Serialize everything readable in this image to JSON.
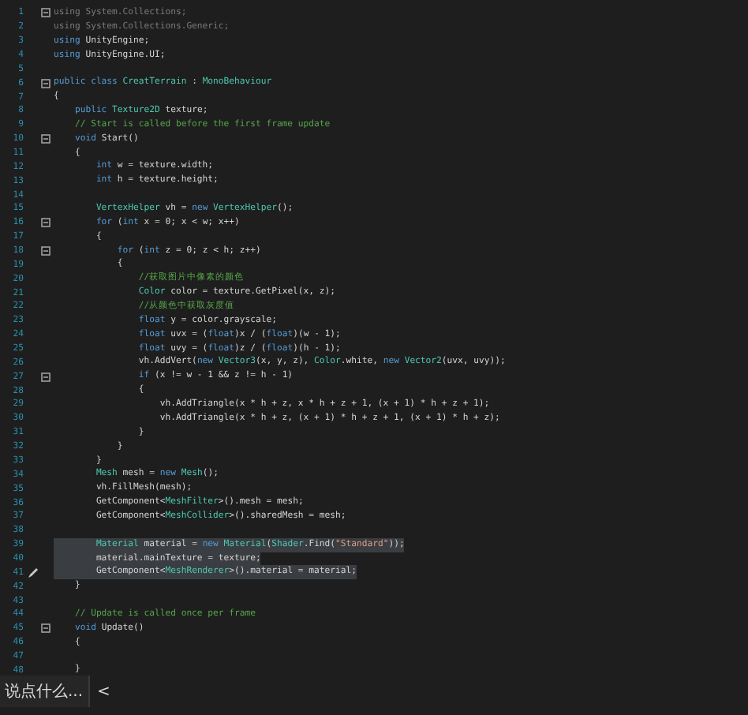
{
  "editor": {
    "lines": [
      {
        "number": "1",
        "fold": true,
        "selected": false,
        "tokens": [
          {
            "kind": "dim",
            "text": "using System.Collections;"
          }
        ]
      },
      {
        "number": "2",
        "fold": false,
        "selected": false,
        "tokens": [
          {
            "kind": "dim",
            "text": "using System.Collections.Generic;"
          }
        ]
      },
      {
        "number": "3",
        "fold": false,
        "selected": false,
        "tokens": [
          {
            "kind": "keyword",
            "text": "using"
          },
          {
            "kind": "plain",
            "text": " UnityEngine;"
          }
        ]
      },
      {
        "number": "4",
        "fold": false,
        "selected": false,
        "tokens": [
          {
            "kind": "keyword",
            "text": "using"
          },
          {
            "kind": "plain",
            "text": " UnityEngine.UI;"
          }
        ]
      },
      {
        "number": "5",
        "fold": false,
        "selected": false
      },
      {
        "number": "6",
        "fold": true,
        "selected": false,
        "tokens": [
          {
            "kind": "keyword",
            "text": "public class"
          },
          {
            "kind": "type",
            "text": " CreatTerrain"
          },
          {
            "kind": "plain",
            "text": " : "
          },
          {
            "kind": "type",
            "text": "MonoBehaviour"
          }
        ]
      },
      {
        "number": "7",
        "fold": false,
        "selected": false,
        "tokens": [
          {
            "kind": "plain",
            "text": "{"
          }
        ]
      },
      {
        "number": "8",
        "fold": false,
        "selected": false,
        "tokens": [
          {
            "kind": "keyword",
            "text": "    public"
          },
          {
            "kind": "type",
            "text": " Texture2D"
          },
          {
            "kind": "plain",
            "text": " texture;"
          }
        ]
      },
      {
        "number": "9",
        "fold": false,
        "selected": false,
        "tokens": [
          {
            "kind": "comment",
            "text": "    // Start is called before the first frame update"
          }
        ]
      },
      {
        "number": "10",
        "fold": true,
        "selected": false,
        "tokens": [
          {
            "kind": "keyword",
            "text": "    void"
          },
          {
            "kind": "plain",
            "text": " Start()"
          }
        ]
      },
      {
        "number": "11",
        "fold": false,
        "selected": false,
        "tokens": [
          {
            "kind": "plain",
            "text": "    {"
          }
        ]
      },
      {
        "number": "12",
        "fold": false,
        "selected": false,
        "tokens": [
          {
            "kind": "keyword",
            "text": "        int"
          },
          {
            "kind": "plain",
            "text": " w = texture.width;"
          }
        ]
      },
      {
        "number": "13",
        "fold": false,
        "selected": false,
        "tokens": [
          {
            "kind": "keyword",
            "text": "        int"
          },
          {
            "kind": "plain",
            "text": " h = texture.height;"
          }
        ]
      },
      {
        "number": "14",
        "fold": false,
        "selected": false
      },
      {
        "number": "15",
        "fold": false,
        "selected": false,
        "tokens": [
          {
            "kind": "type",
            "text": "        VertexHelper"
          },
          {
            "kind": "plain",
            "text": " vh = "
          },
          {
            "kind": "keyword",
            "text": "new"
          },
          {
            "kind": "type",
            "text": " VertexHelper"
          },
          {
            "kind": "plain",
            "text": "();"
          }
        ]
      },
      {
        "number": "16",
        "fold": true,
        "selected": false,
        "tokens": [
          {
            "kind": "keyword",
            "text": "        for"
          },
          {
            "kind": "plain",
            "text": " ("
          },
          {
            "kind": "keyword",
            "text": "int"
          },
          {
            "kind": "plain",
            "text": " x = 0; x < w; x++)"
          }
        ]
      },
      {
        "number": "17",
        "fold": false,
        "selected": false,
        "tokens": [
          {
            "kind": "plain",
            "text": "        {"
          }
        ]
      },
      {
        "number": "18",
        "fold": true,
        "selected": false,
        "tokens": [
          {
            "kind": "keyword",
            "text": "            for"
          },
          {
            "kind": "plain",
            "text": " ("
          },
          {
            "kind": "keyword",
            "text": "int"
          },
          {
            "kind": "plain",
            "text": " z = 0; z < h; z++)"
          }
        ]
      },
      {
        "number": "19",
        "fold": false,
        "selected": false,
        "tokens": [
          {
            "kind": "plain",
            "text": "            {"
          }
        ]
      },
      {
        "number": "20",
        "fold": false,
        "selected": false,
        "tokens": [
          {
            "kind": "comment",
            "text": "                //获取图片中像素的颜色"
          }
        ]
      },
      {
        "number": "21",
        "fold": false,
        "selected": false,
        "tokens": [
          {
            "kind": "type",
            "text": "                Color"
          },
          {
            "kind": "plain",
            "text": " color = texture.GetPixel(x, z);"
          }
        ]
      },
      {
        "number": "22",
        "fold": false,
        "selected": false,
        "tokens": [
          {
            "kind": "comment",
            "text": "                //从颜色中获取灰度值"
          }
        ]
      },
      {
        "number": "23",
        "fold": false,
        "selected": false,
        "tokens": [
          {
            "kind": "keyword",
            "text": "                float"
          },
          {
            "kind": "plain",
            "text": " y = color.grayscale;"
          }
        ]
      },
      {
        "number": "24",
        "fold": false,
        "selected": false,
        "tokens": [
          {
            "kind": "keyword",
            "text": "                float"
          },
          {
            "kind": "plain",
            "text": " uvx = ("
          },
          {
            "kind": "keyword",
            "text": "float"
          },
          {
            "kind": "plain",
            "text": ")x / ("
          },
          {
            "kind": "keyword",
            "text": "float"
          },
          {
            "kind": "plain",
            "text": ")(w - 1);"
          }
        ]
      },
      {
        "number": "25",
        "fold": false,
        "selected": false,
        "tokens": [
          {
            "kind": "keyword",
            "text": "                float"
          },
          {
            "kind": "plain",
            "text": " uvy = ("
          },
          {
            "kind": "keyword",
            "text": "float"
          },
          {
            "kind": "plain",
            "text": ")z / ("
          },
          {
            "kind": "keyword",
            "text": "float"
          },
          {
            "kind": "plain",
            "text": ")(h - 1);"
          }
        ]
      },
      {
        "number": "26",
        "fold": false,
        "selected": false,
        "tokens": [
          {
            "kind": "plain",
            "text": "                vh.AddVert("
          },
          {
            "kind": "keyword",
            "text": "new"
          },
          {
            "kind": "type",
            "text": " Vector3"
          },
          {
            "kind": "plain",
            "text": "(x, y, z), "
          },
          {
            "kind": "type",
            "text": "Color"
          },
          {
            "kind": "plain",
            "text": ".white, "
          },
          {
            "kind": "keyword",
            "text": "new"
          },
          {
            "kind": "type",
            "text": " Vector2"
          },
          {
            "kind": "plain",
            "text": "(uvx, uvy));"
          }
        ]
      },
      {
        "number": "27",
        "fold": true,
        "selected": false,
        "tokens": [
          {
            "kind": "keyword",
            "text": "                if"
          },
          {
            "kind": "plain",
            "text": " (x != w - 1 && z != h - 1)"
          }
        ]
      },
      {
        "number": "28",
        "fold": false,
        "selected": false,
        "tokens": [
          {
            "kind": "plain",
            "text": "                {"
          }
        ]
      },
      {
        "number": "29",
        "fold": false,
        "selected": false,
        "tokens": [
          {
            "kind": "plain",
            "text": "                    vh.AddTriangle(x * h + z, x * h + z + 1, (x + 1) * h + z + 1);"
          }
        ]
      },
      {
        "number": "30",
        "fold": false,
        "selected": false,
        "tokens": [
          {
            "kind": "plain",
            "text": "                    vh.AddTriangle(x * h + z, (x + 1) * h + z + 1, (x + 1) * h + z);"
          }
        ]
      },
      {
        "number": "31",
        "fold": false,
        "selected": false,
        "tokens": [
          {
            "kind": "plain",
            "text": "                }"
          }
        ]
      },
      {
        "number": "32",
        "fold": false,
        "selected": false,
        "tokens": [
          {
            "kind": "plain",
            "text": "            }"
          }
        ]
      },
      {
        "number": "33",
        "fold": false,
        "selected": false,
        "tokens": [
          {
            "kind": "plain",
            "text": "        }"
          }
        ]
      },
      {
        "number": "34",
        "fold": false,
        "selected": false,
        "tokens": [
          {
            "kind": "type",
            "text": "        Mesh"
          },
          {
            "kind": "plain",
            "text": " mesh = "
          },
          {
            "kind": "keyword",
            "text": "new"
          },
          {
            "kind": "type",
            "text": " Mesh"
          },
          {
            "kind": "plain",
            "text": "();"
          }
        ]
      },
      {
        "number": "35",
        "fold": false,
        "selected": false,
        "tokens": [
          {
            "kind": "plain",
            "text": "        vh.FillMesh(mesh);"
          }
        ]
      },
      {
        "number": "36",
        "fold": false,
        "selected": false,
        "tokens": [
          {
            "kind": "plain",
            "text": "        GetComponent<"
          },
          {
            "kind": "type",
            "text": "MeshFilter"
          },
          {
            "kind": "plain",
            "text": ">().mesh = mesh;"
          }
        ]
      },
      {
        "number": "37",
        "fold": false,
        "selected": false,
        "tokens": [
          {
            "kind": "plain",
            "text": "        GetComponent<"
          },
          {
            "kind": "type",
            "text": "MeshCollider"
          },
          {
            "kind": "plain",
            "text": ">().sharedMesh = mesh;"
          }
        ]
      },
      {
        "number": "38",
        "fold": false,
        "selected": false
      },
      {
        "number": "39",
        "fold": false,
        "selected": true,
        "tokens": [
          {
            "kind": "type",
            "text": "        Material"
          },
          {
            "kind": "plain",
            "text": " material = "
          },
          {
            "kind": "keyword",
            "text": "new"
          },
          {
            "kind": "type",
            "text": " Material"
          },
          {
            "kind": "plain",
            "text": "("
          },
          {
            "kind": "type",
            "text": "Shader"
          },
          {
            "kind": "plain",
            "text": ".Find("
          },
          {
            "kind": "string",
            "text": "\"Standard\""
          },
          {
            "kind": "plain",
            "text": "));"
          }
        ]
      },
      {
        "number": "40",
        "fold": false,
        "selected": true,
        "tokens": [
          {
            "kind": "plain",
            "text": "        material.mainTexture = texture;"
          }
        ]
      },
      {
        "number": "41",
        "fold": false,
        "selected": true,
        "gutter": {
          "kind": "pencil"
        },
        "tokens": [
          {
            "kind": "plain",
            "text": "        GetComponent<"
          },
          {
            "kind": "type",
            "text": "MeshRenderer"
          },
          {
            "kind": "plain",
            "text": ">().material = material;"
          }
        ]
      },
      {
        "number": "42",
        "fold": false,
        "selected": false,
        "tokens": [
          {
            "kind": "plain",
            "text": "    }"
          }
        ]
      },
      {
        "number": "43",
        "fold": false,
        "selected": false
      },
      {
        "number": "44",
        "fold": false,
        "selected": false,
        "tokens": [
          {
            "kind": "comment",
            "text": "    // Update is called once per frame"
          }
        ]
      },
      {
        "number": "45",
        "fold": true,
        "selected": false,
        "tokens": [
          {
            "kind": "keyword",
            "text": "    void"
          },
          {
            "kind": "plain",
            "text": " Update()"
          }
        ]
      },
      {
        "number": "46",
        "fold": false,
        "selected": false,
        "tokens": [
          {
            "kind": "plain",
            "text": "    {"
          }
        ]
      },
      {
        "number": "47",
        "fold": false,
        "selected": false
      },
      {
        "number": "48",
        "fold": false,
        "selected": false,
        "tokens": [
          {
            "kind": "plain",
            "text": "    }"
          }
        ]
      }
    ]
  },
  "comment_bar": {
    "placeholder": "说点什么...",
    "collapse": "<"
  }
}
